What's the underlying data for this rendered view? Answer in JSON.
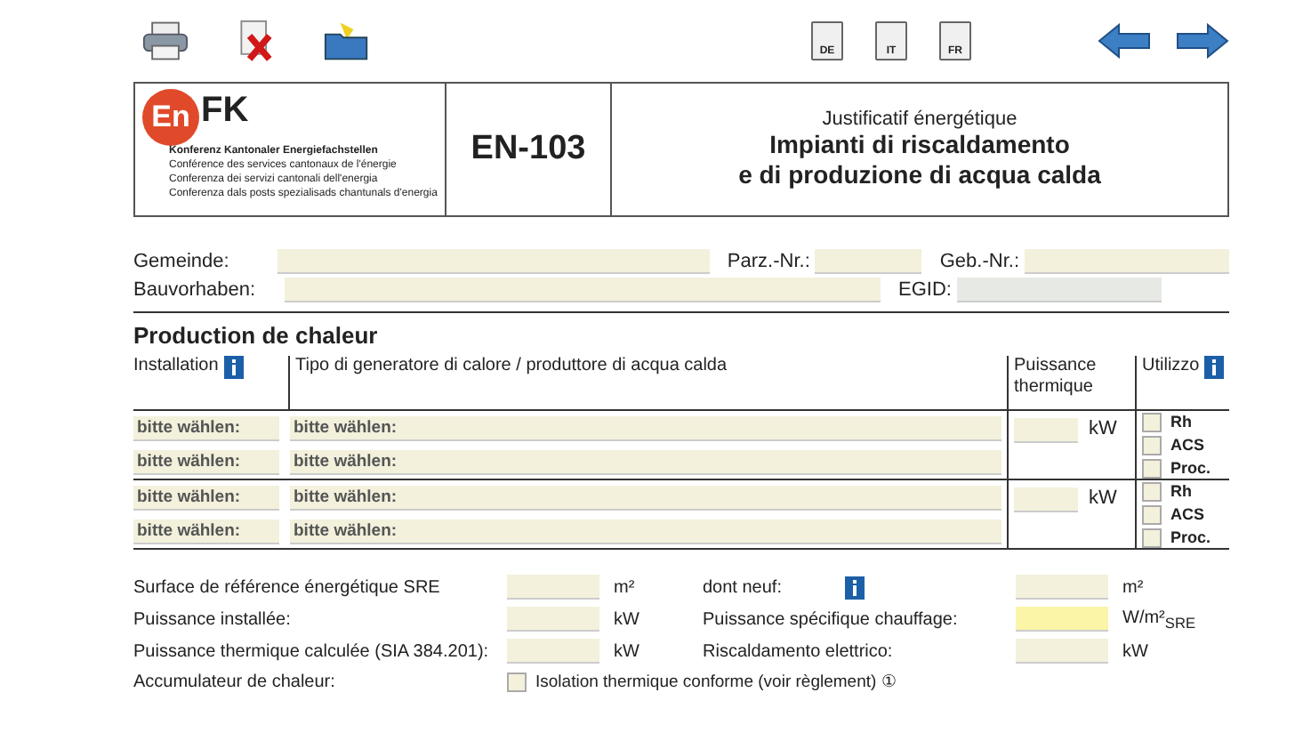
{
  "toolbar": {
    "languages": [
      "DE",
      "IT",
      "FR"
    ]
  },
  "header": {
    "logo_left": "En",
    "logo_right": "FK",
    "org_lines": [
      "Konferenz Kantonaler Energiefachstellen",
      "Conférence des services cantonaux de l'énergie",
      "Conferenza dei servizi cantonali dell'energia",
      "Conferenza dals posts spezialisads chantunals d'energia"
    ],
    "form_code": "EN-103",
    "title_lines": [
      "Justificatif énergétique",
      "Impianti di riscaldamento",
      "e di produzione di acqua calda"
    ]
  },
  "fields": [
    [
      {
        "label": "Gemeinde:",
        "disabled": false
      },
      {
        "label": "Parz.-Nr.:",
        "disabled": false
      },
      {
        "label": "Geb.-Nr.:",
        "disabled": false
      }
    ],
    [
      {
        "label": "Bauvorhaben:",
        "disabled": false
      },
      {
        "label": "EGID:",
        "disabled": true
      }
    ]
  ],
  "section_title": "Production de chaleur",
  "columns": [
    {
      "label": "Installation",
      "info": true
    },
    {
      "label": "Tipo di generatore di calore / produttore di acqua calda",
      "info": false
    },
    {
      "label": "Puissance thermique",
      "info": false
    },
    {
      "label": "Utilizzo",
      "info": true
    }
  ],
  "groups": [
    {
      "rows": [
        {
          "installation": "bitte wählen:",
          "type": "bitte wählen:"
        },
        {
          "installation": "bitte wählen:",
          "type": "bitte wählen:"
        }
      ],
      "unit": "kW",
      "uses": [
        {
          "label": "Rh",
          "checked": false
        },
        {
          "label": "ACS",
          "checked": false
        },
        {
          "label": "Proc.",
          "checked": false
        }
      ]
    },
    {
      "rows": [
        {
          "installation": "bitte wählen:",
          "type": "bitte wählen:"
        },
        {
          "installation": "bitte wählen:",
          "type": "bitte wählen:"
        }
      ],
      "unit": "kW",
      "uses": [
        {
          "label": "Rh",
          "checked": false
        },
        {
          "label": "ACS",
          "checked": false
        },
        {
          "label": "Proc.",
          "checked": false
        }
      ]
    }
  ],
  "summary": [
    {
      "left": {
        "label": "Surface de référence énergétique SRE",
        "unit": "m²"
      },
      "right": {
        "label": "dont neuf:",
        "info": true,
        "unit": "m²",
        "highlight": false
      }
    },
    {
      "left": {
        "label": "Puissance installée:",
        "unit": "kW"
      },
      "right": {
        "label": "Puissance spécifique chauffage:",
        "info": false,
        "unit": "W/m²$_{SRE}$",
        "highlight": true
      }
    },
    {
      "left": {
        "label": "Puissance thermique calculée (SIA 384.201):",
        "unit": "kW"
      },
      "right": {
        "label": "Riscaldamento elettrico:",
        "info": false,
        "unit": "kW",
        "highlight": false
      }
    }
  ],
  "storage": {
    "label": "Accumulateur de chaleur:",
    "checked": false,
    "option": "Isolation thermique conforme (voir règlement) ①"
  }
}
